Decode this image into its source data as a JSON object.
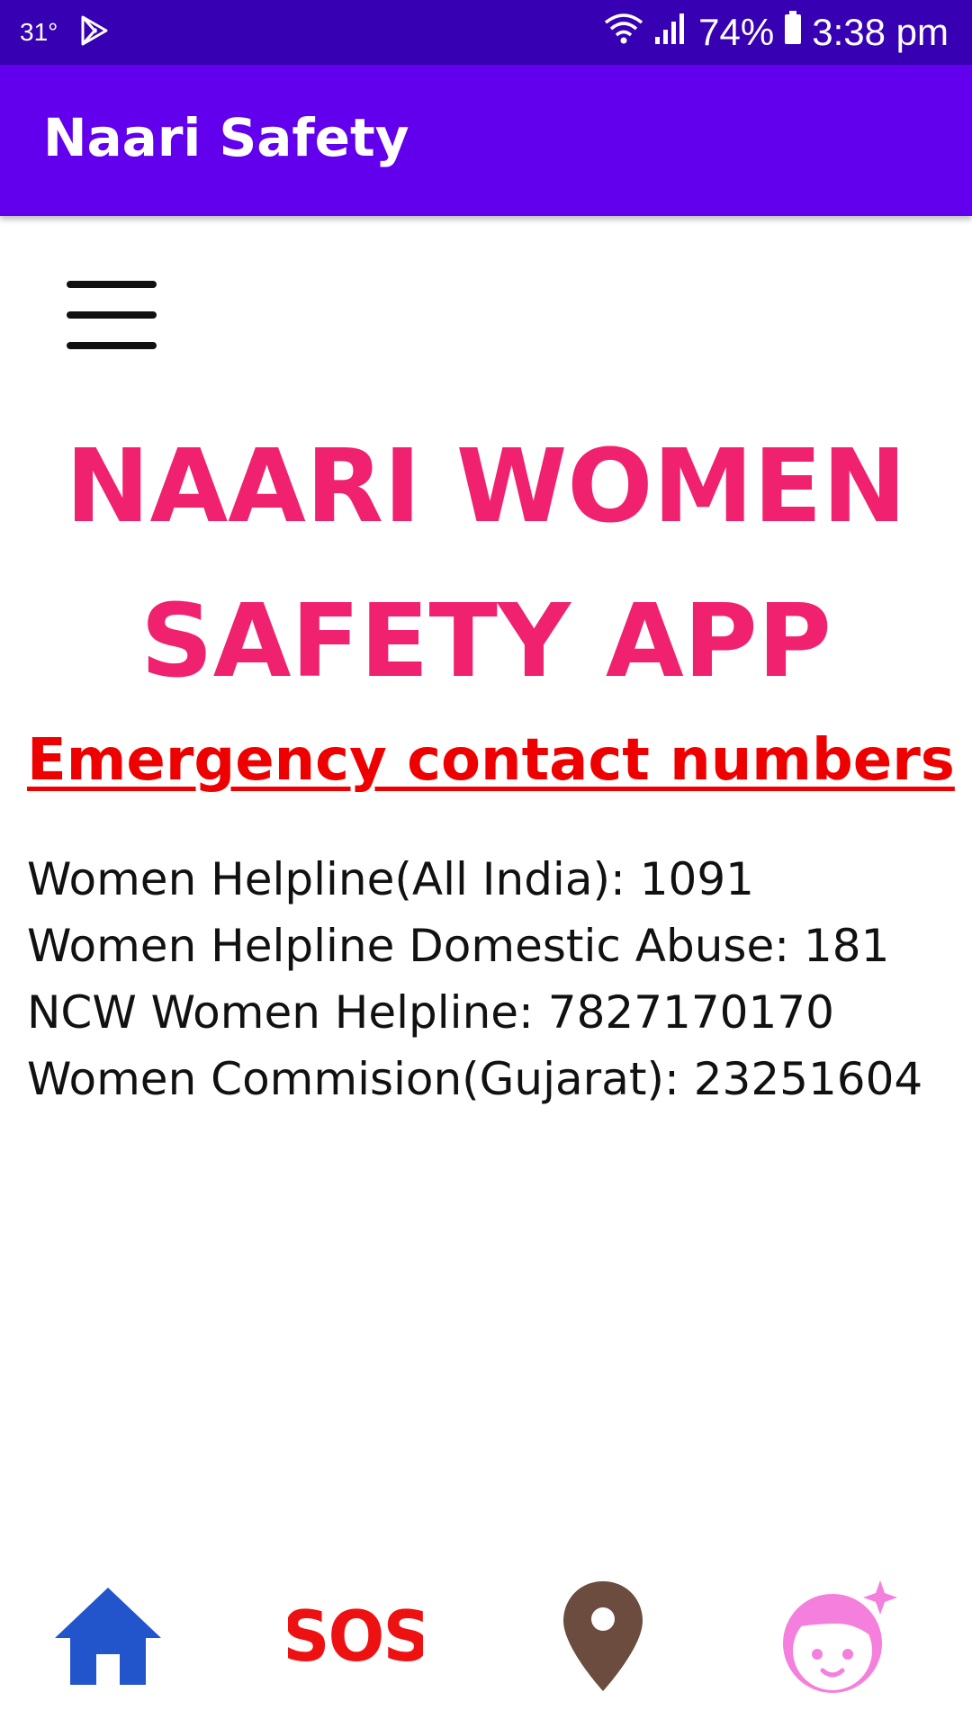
{
  "status_bar": {
    "temperature": "31°",
    "play_icon": "play-store-icon",
    "wifi_icon": "wifi-icon",
    "signal_icon": "signal-icon",
    "battery_percent": "74%",
    "battery_icon": "battery-icon",
    "time": "3:38 pm"
  },
  "app_bar": {
    "title": "Naari Safety"
  },
  "menu": {
    "icon": "hamburger-menu-icon"
  },
  "hero": {
    "line1": "NAARI WOMEN",
    "line2": "SAFETY APP"
  },
  "emergency": {
    "heading": "Emergency contact numbers",
    "contacts": [
      "Women Helpline(All India): 1091",
      "Women Helpline Domestic Abuse: 181",
      "NCW Women Helpline: 7827170170",
      "Women Commision(Gujarat): 23251604"
    ]
  },
  "bottom_nav": {
    "home_icon": "home-icon",
    "sos_label": "SOS",
    "location_icon": "location-pin-icon",
    "profile_icon": "girl-face-icon"
  },
  "colors": {
    "status_bar": "#3700b3",
    "app_bar": "#6200ee",
    "hero_pink": "#f0216e",
    "heading_red": "#ee0000",
    "home_blue": "#2255cc",
    "sos_red": "#ee1111",
    "pin_brown": "#6b4c3f",
    "face_pink": "#f47fdc"
  }
}
